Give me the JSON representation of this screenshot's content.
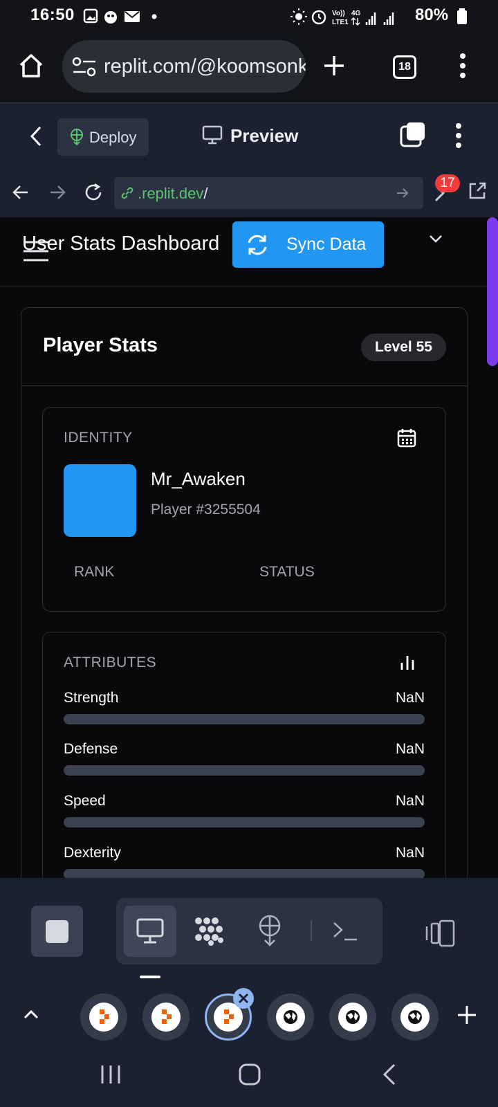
{
  "status_bar": {
    "time": "16:50",
    "network": "Vo)) LTE1 4G",
    "battery": "80%"
  },
  "browser": {
    "url": "replit.com/@koomsonk",
    "tab_count": "18"
  },
  "replit_header": {
    "deploy_label": "Deploy",
    "preview_label": "Preview"
  },
  "inner_nav": {
    "url_host": ".replit.dev",
    "url_path": "/",
    "devtools_badge": "17"
  },
  "app": {
    "title": "User Stats Dashboard",
    "sync_button": "Sync Data",
    "card_title": "Player Stats",
    "level": "Level 55",
    "identity": {
      "label": "IDENTITY",
      "player_name": "Mr_Awaken",
      "player_id": "Player #3255504",
      "rank_label": "RANK",
      "status_label": "STATUS",
      "avatar_color": "#2196f3"
    },
    "attributes": {
      "label": "ATTRIBUTES",
      "items": [
        {
          "name": "Strength",
          "value": "NaN"
        },
        {
          "name": "Defense",
          "value": "NaN"
        },
        {
          "name": "Speed",
          "value": "NaN"
        },
        {
          "name": "Dexterity",
          "value": "NaN"
        }
      ]
    }
  },
  "colors": {
    "accent": "#2196f3",
    "scrollbar": "#7c3aed",
    "link_green": "#5cc26d",
    "badge_red": "#f23b3b"
  },
  "icons": {
    "toolbar": [
      "stop-icon",
      "monitor-icon",
      "workflow-icon",
      "deploy-icon",
      "terminal-icon",
      "device-toggle-icon"
    ],
    "tabs": [
      "replit-icon",
      "replit-icon",
      "replit-icon",
      "globe-icon",
      "globe-icon",
      "globe-icon"
    ]
  }
}
